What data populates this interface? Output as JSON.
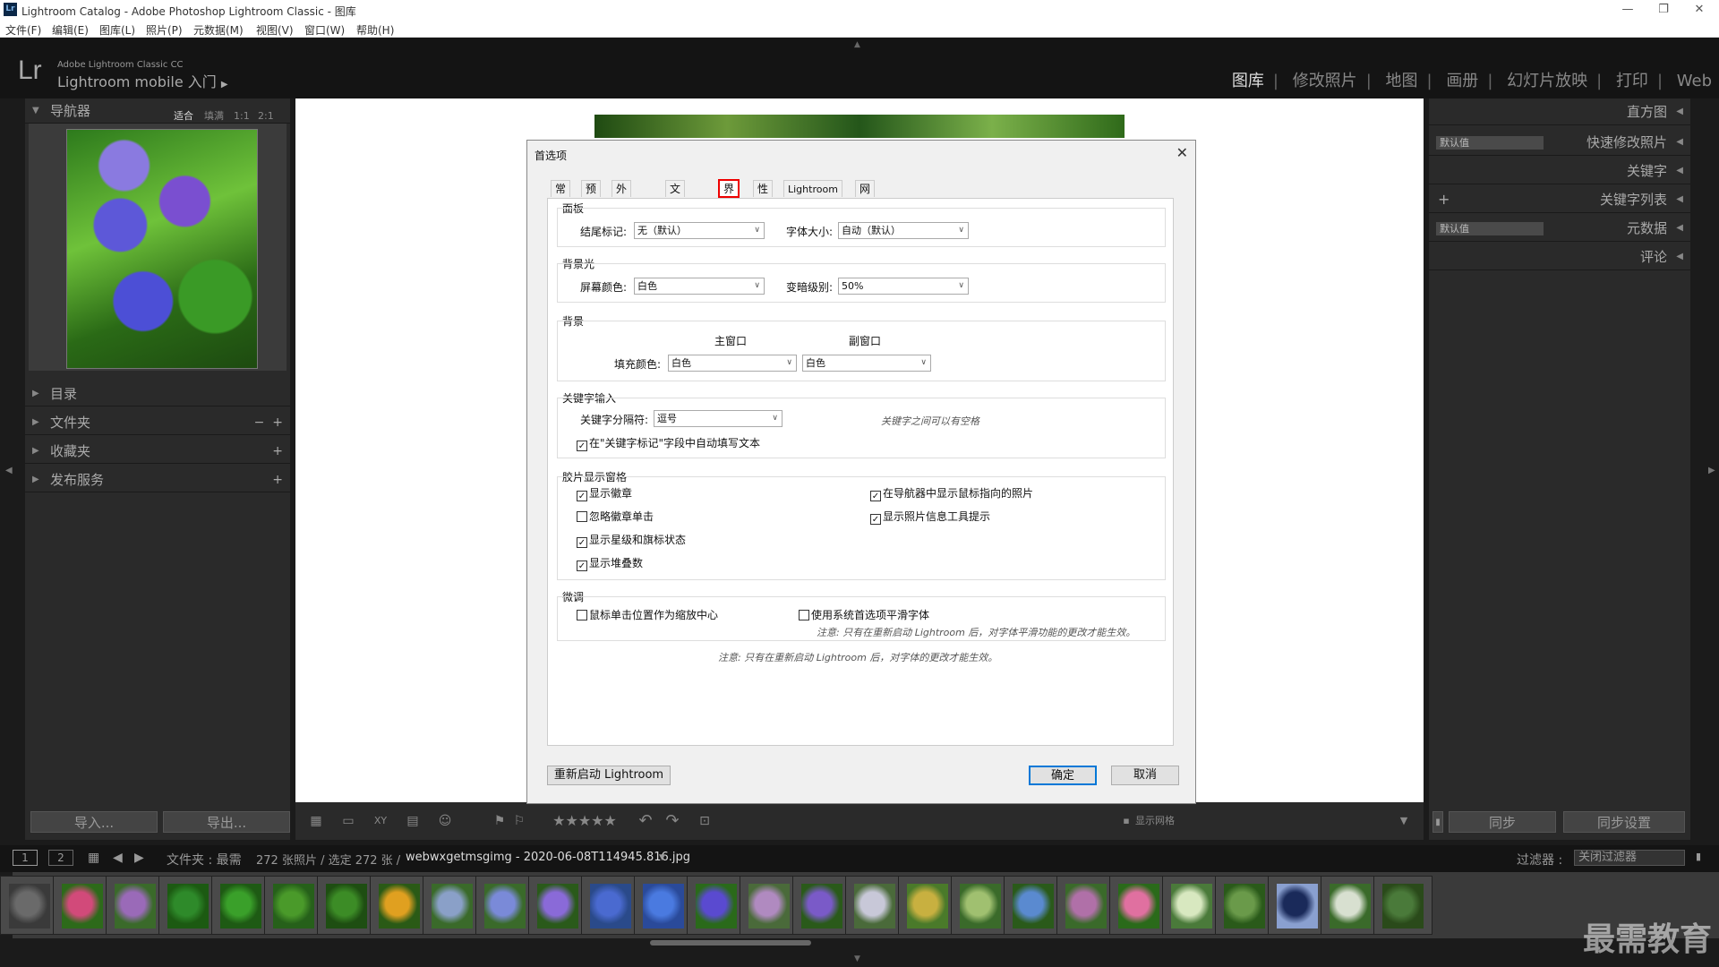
{
  "window": {
    "title": "Lightroom Catalog - Adobe Photoshop Lightroom Classic - 图库",
    "app_icon": "Lr"
  },
  "menu": [
    "文件(F)",
    "编辑(E)",
    "图库(L)",
    "照片(P)",
    "元数据(M)",
    "视图(V)",
    "窗口(W)",
    "帮助(H)"
  ],
  "identity": {
    "logo": "Lr",
    "product": "Adobe Lightroom Classic CC",
    "subtitle": "Lightroom mobile 入门"
  },
  "modules": [
    "图库",
    "修改照片",
    "地图",
    "画册",
    "幻灯片放映",
    "打印",
    "Web"
  ],
  "left_panel": {
    "navigator": {
      "label": "导航器",
      "options": [
        "适合",
        "填满",
        "1:1",
        "2:1"
      ]
    },
    "sections": [
      "目录",
      "文件夹",
      "收藏夹",
      "发布服务"
    ],
    "import_label": "导入...",
    "export_label": "导出..."
  },
  "right_panel": {
    "sections": [
      "直方图",
      "快速修改照片",
      "关键字",
      "关键字列表",
      "元数据",
      "评论"
    ],
    "quick_develop_preset": "默认值",
    "metadata_preset": "默认值",
    "sync_label": "同步",
    "sync_settings_label": "同步设置"
  },
  "toolbar": {
    "stars": "★★★★★",
    "show_grid": "显示网格"
  },
  "filmstrip_bar": {
    "pages": [
      "1",
      "2"
    ],
    "source": "文件夹 : 最需",
    "count": "272 张照片 / 选定 272 张 /",
    "filename": "webwxgetmsgimg - 2020-06-08T114945.816.jpg",
    "filter_label": "过滤器 :",
    "filter_value": "关闭过滤器"
  },
  "dialog": {
    "title": "首选项",
    "tabs": [
      "常规",
      "预设",
      "外部编辑",
      "文件处理",
      "界面",
      "性能",
      "Lightroom CC",
      "网络"
    ],
    "active_tab": "界面",
    "panels": {
      "title": "面板",
      "end_mark_label": "结尾标记:",
      "end_mark_value": "无（默认）",
      "font_size_label": "字体大小:",
      "font_size_value": "自动（默认）"
    },
    "lights_out": {
      "title": "背景光",
      "screen_color_label": "屏幕颜色:",
      "screen_color_value": "白色",
      "dim_level_label": "变暗级别:",
      "dim_level_value": "50%"
    },
    "background": {
      "title": "背景",
      "main_window": "主窗口",
      "secondary_window": "副窗口",
      "fill_color_label": "填充颜色:",
      "main_value": "白色",
      "secondary_value": "白色"
    },
    "keyword_entry": {
      "title": "关键字输入",
      "separator_label": "关键字分隔符:",
      "separator_value": "逗号",
      "separator_note": "关键字之间可以有空格",
      "autofill": "在\"关键字标记\"字段中自动填写文本"
    },
    "filmstrip": {
      "title": "胶片显示窗格",
      "show_badges": "显示徽章",
      "ignore_badge_clicks": "忽略徽章单击",
      "show_ratings": "显示星级和旗标状态",
      "show_stack_counts": "显示堆叠数",
      "show_navigator_hover": "在导航器中显示鼠标指向的照片",
      "show_info_tooltips": "显示照片信息工具提示"
    },
    "tweaks": {
      "title": "微调",
      "zoom_click": "鼠标单击位置作为缩放中心",
      "system_smoothing": "使用系统首选项平滑字体",
      "smoothing_note": "注意: 只有在重新启动 Lightroom 后，对字体平滑功能的更改才能生效。"
    },
    "restart_note": "注意: 只有在重新启动 Lightroom 后，对字体的更改才能生效。",
    "restart_button": "重新启动 Lightroom",
    "ok_button": "确定",
    "cancel_button": "取消"
  },
  "watermark": "最需教育",
  "colors": {
    "dark_bg": "#1b1b1b",
    "panel_bg": "#2a2a2a",
    "highlight": "#ee0000"
  }
}
